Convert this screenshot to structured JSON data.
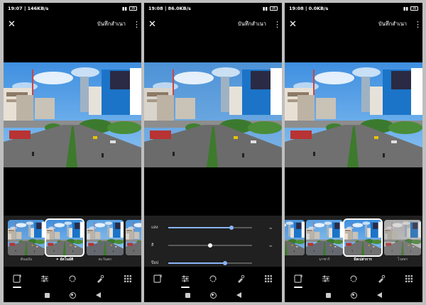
{
  "header": {
    "close_icon": "close-icon",
    "save_label": "บันทึกสำเนา",
    "more_icon": "more-vert-icon"
  },
  "screens": [
    {
      "status": {
        "time": "19:07",
        "speed": "146KB/s",
        "battery": "36"
      },
      "mode": "filters",
      "thumbs": [
        {
          "label": "ต้นฉบับ"
        },
        {
          "label": "อัตโนมัติ",
          "icon": "sparkle-icon",
          "selected": true
        },
        {
          "label": "ตะวันตก"
        },
        {
          "label": "พ"
        }
      ]
    },
    {
      "status": {
        "time": "19:08",
        "speed": "86.0KB/s",
        "battery": "36"
      },
      "mode": "adjust",
      "sliders": [
        {
          "label": "แสง",
          "value": 0.75,
          "icon": "chevron-down-icon"
        },
        {
          "label": "สี",
          "value": 0.5,
          "icon": "chevron-down-icon"
        },
        {
          "label": "ป๊อป",
          "value": 0.68
        }
      ]
    },
    {
      "status": {
        "time": "19:08",
        "speed": "0.0KB/s",
        "battery": "36"
      },
      "mode": "filters",
      "thumbs": [
        {
          "label": ""
        },
        {
          "label": "มาซาร์"
        },
        {
          "label": "มีสเปล่าการ",
          "selected": true
        },
        {
          "label": "โวลทา"
        }
      ]
    }
  ],
  "tools": [
    {
      "name": "suggestions-icon"
    },
    {
      "name": "adjust-sliders-icon"
    },
    {
      "name": "crop-rotate-icon"
    },
    {
      "name": "markup-icon"
    },
    {
      "name": "more-tools-icon"
    }
  ],
  "nav": {
    "recents": "recents-square-icon",
    "home": "home-circle-icon",
    "back": "back-triangle-icon"
  },
  "colors": {
    "accent": "#8ab4f8",
    "panel": "#202020",
    "background": "#000000",
    "frame": "#bfbfbf"
  }
}
